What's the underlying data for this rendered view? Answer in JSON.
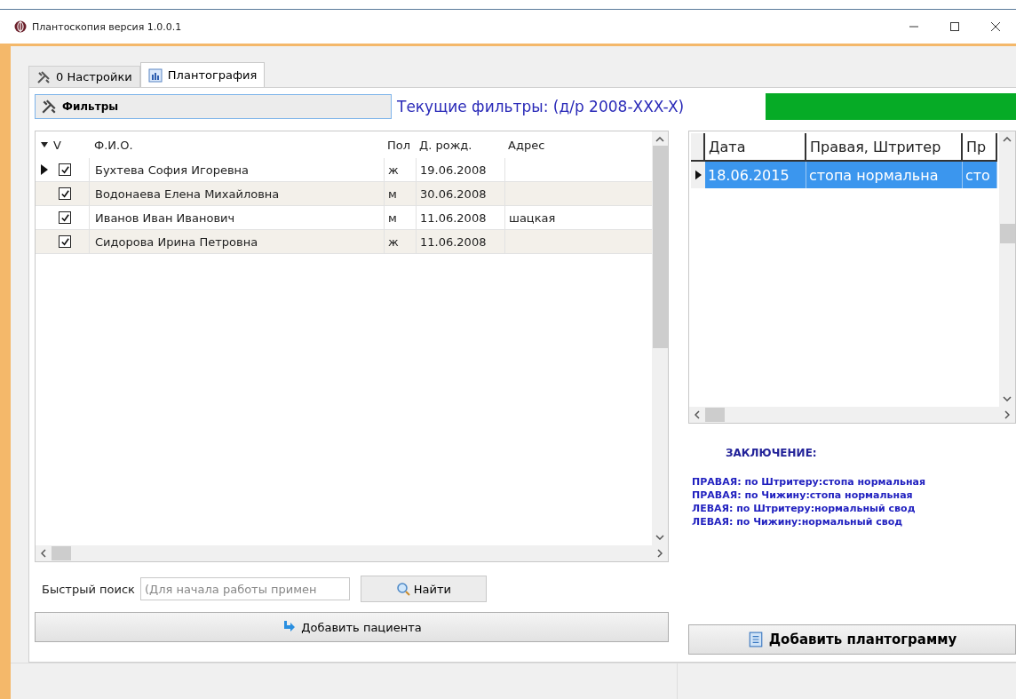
{
  "window": {
    "title": "Плантоскопия версия 1.0.0.1"
  },
  "tabs": [
    {
      "label": "0 Настройки",
      "selected": false
    },
    {
      "label": "Плантография",
      "selected": true
    }
  ],
  "filters_button": "Фильтры",
  "current_filters": "Текущие фильтры: (д/р 2008-XXX-X)",
  "progress": {
    "level": 1
  },
  "patients": {
    "columns": [
      "V",
      "Ф.И.О.",
      "Пол",
      "Д. рожд.",
      "Адрес"
    ],
    "rows": [
      {
        "selected": true,
        "checked": true,
        "name": "Бухтева София Игоревна",
        "sex": "ж",
        "dob": "19.06.2008",
        "address": ""
      },
      {
        "selected": false,
        "checked": true,
        "name": "Водонаева Елена Михайловна",
        "sex": "м",
        "dob": "30.06.2008",
        "address": ""
      },
      {
        "selected": false,
        "checked": true,
        "name": "Иванов Иван Иванович",
        "sex": "м",
        "dob": "11.06.2008",
        "address": "шацкая"
      },
      {
        "selected": false,
        "checked": true,
        "name": "Сидорова Ирина Петровна",
        "sex": "ж",
        "dob": "11.06.2008",
        "address": ""
      }
    ]
  },
  "quick_search": {
    "label": "Быстрый поиск",
    "placeholder": "(Для начала работы примен",
    "button": "Найти"
  },
  "add_patient": "Добавить пациента",
  "plantograms": {
    "columns": [
      "Дата",
      "Правая, Штритер",
      "Пр"
    ],
    "rows": [
      {
        "selected": true,
        "cells": [
          "18.06.2015",
          "стопа нормальна",
          "сто"
        ]
      }
    ]
  },
  "conclusion": {
    "title": "ЗАКЛЮЧЕНИЕ:",
    "lines": [
      "ПРАВАЯ: по Штритеру:стопа нормальная",
      "ПРАВАЯ: по Чижину:стопа нормальная",
      "ЛЕВАЯ: по Штритеру:нормальный свод",
      "ЛЕВАЯ: по Чижину:нормальный свод"
    ]
  },
  "add_plantogram": "Добавить плантограмму"
}
